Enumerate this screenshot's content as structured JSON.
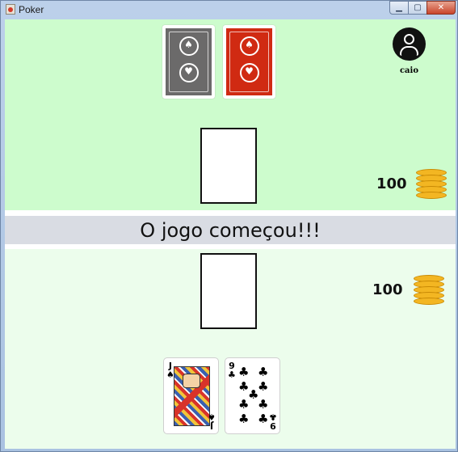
{
  "window": {
    "title": "Poker"
  },
  "opponent": {
    "name": "caio",
    "chips": "100"
  },
  "player": {
    "chips": "100"
  },
  "banner": {
    "message": "O jogo começou!!!"
  },
  "player_hand": [
    {
      "rank": "J",
      "suit": "♠",
      "suit_name": "spades"
    },
    {
      "rank": "9",
      "suit": "♣",
      "suit_name": "clubs"
    }
  ],
  "card_backs": [
    {
      "color": "#6b6a6a"
    },
    {
      "color": "#d02a12"
    }
  ],
  "colors": {
    "table_top": "#cdfccd",
    "table_bottom": "#ecfdec",
    "banner": "#d9dce3",
    "coin": "#f3b622"
  }
}
